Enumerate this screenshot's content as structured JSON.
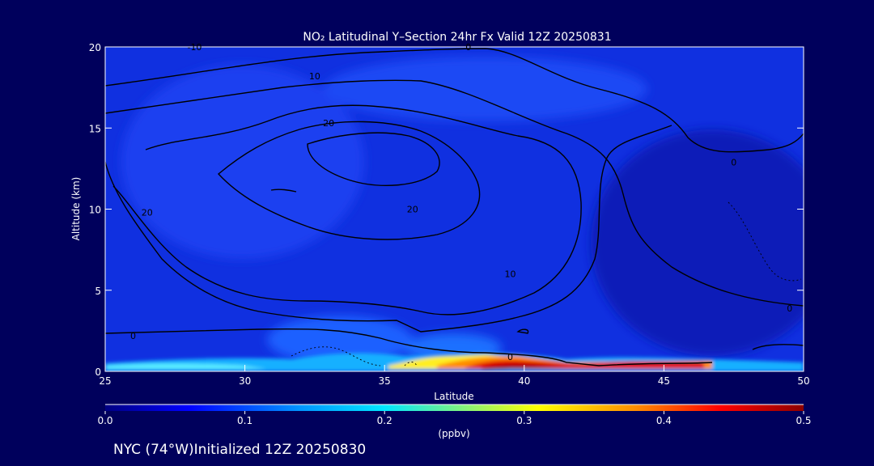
{
  "chart_data": {
    "type": "heatmap",
    "title": "NO₂ Latitudinal Y–Section 24hr  Fx Valid 12Z 20250831",
    "xlabel": "Latitude",
    "ylabel": "Altitude (km)",
    "xlim": [
      25,
      50
    ],
    "ylim": [
      0,
      20
    ],
    "x_ticks": [
      25,
      30,
      35,
      40,
      45,
      50
    ],
    "y_ticks": [
      0,
      5,
      10,
      15,
      20
    ],
    "colorbar": {
      "label": "(ppbv)",
      "min": 0.0,
      "max": 0.5,
      "ticks": [
        "0.0",
        "0.1",
        "0.2",
        "0.3",
        "0.4",
        "0.5"
      ],
      "colors": [
        "#000082",
        "#0000ff",
        "#0096ff",
        "#00e6ff",
        "#ffff00",
        "#ff8c00",
        "#ff0000",
        "#8c0000"
      ]
    },
    "field_points": [
      {
        "lat": 38.5,
        "alt": 0.2,
        "value": 0.5
      },
      {
        "lat": 40.0,
        "alt": 0.2,
        "value": 0.48
      },
      {
        "lat": 42.5,
        "alt": 0.2,
        "value": 0.45
      },
      {
        "lat": 44.5,
        "alt": 0.3,
        "value": 0.45
      },
      {
        "lat": 36.5,
        "alt": 0.3,
        "value": 0.35
      },
      {
        "lat": 26.0,
        "alt": 0.2,
        "value": 0.25
      },
      {
        "lat": 29.0,
        "alt": 0.2,
        "value": 0.2
      },
      {
        "lat": 35.0,
        "alt": 1.5,
        "value": 0.15
      },
      {
        "lat": 33.0,
        "alt": 1.0,
        "value": 0.14
      },
      {
        "lat": 30.0,
        "alt": 10.0,
        "value": 0.06
      },
      {
        "lat": 47.0,
        "alt": 10.0,
        "value": 0.03
      }
    ],
    "contour_labels": [
      {
        "text": "10",
        "lat": 32.5,
        "alt": 18.2
      },
      {
        "text": "20",
        "lat": 33.0,
        "alt": 15.3
      },
      {
        "text": "20",
        "lat": 26.5,
        "alt": 9.8
      },
      {
        "text": "20",
        "lat": 36.0,
        "alt": 10.0
      },
      {
        "text": "10",
        "lat": 39.5,
        "alt": 6.0
      },
      {
        "text": "0",
        "lat": 47.5,
        "alt": 12.9
      },
      {
        "text": "0",
        "lat": 49.5,
        "alt": 3.9
      },
      {
        "text": "0",
        "lat": 26.0,
        "alt": 2.2
      },
      {
        "text": "0",
        "lat": 39.5,
        "alt": 0.9
      },
      {
        "text": "0",
        "lat": 38.0,
        "alt": 20.0
      },
      {
        "text": "-10",
        "lat": 28.2,
        "alt": 20.0
      }
    ]
  },
  "footer": {
    "text": "NYC (74°W)Initialized 12Z 20250830"
  }
}
